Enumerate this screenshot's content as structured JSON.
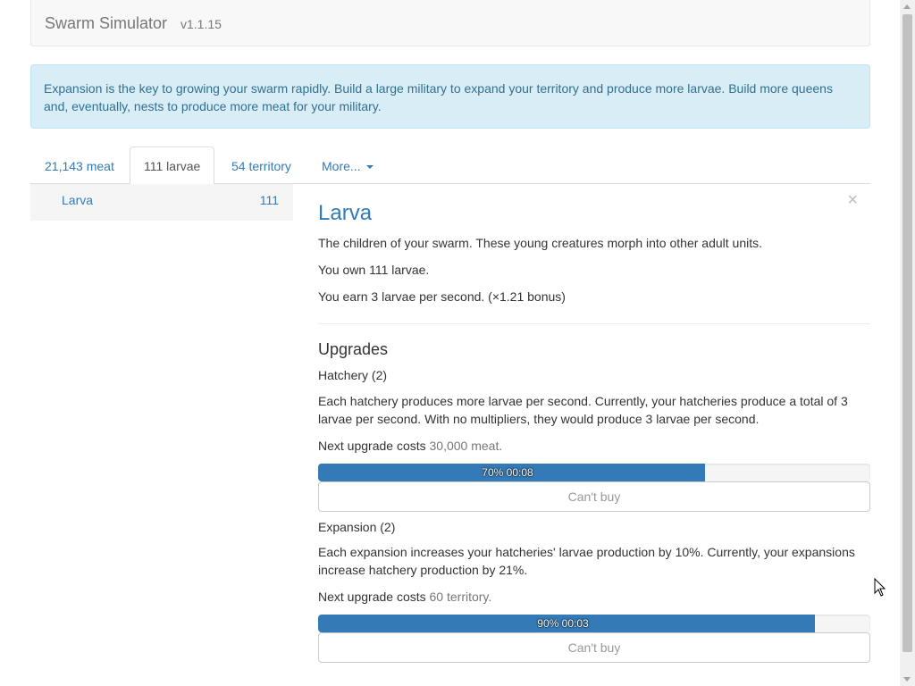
{
  "header": {
    "brand": "Swarm Simulator",
    "version": "v1.1.15"
  },
  "alert": {
    "text": "Expansion is the key to growing your swarm rapidly. Build a large military to expand your territory and produce more larvae. Build more queens and, eventually, nests to produce more meat for your military."
  },
  "tabs": [
    {
      "label": "21,143 meat",
      "active": false
    },
    {
      "label": "111 larvae",
      "active": true
    },
    {
      "label": "54 territory",
      "active": false
    },
    {
      "label": "More...",
      "active": false
    }
  ],
  "sidebar": {
    "items": [
      {
        "label": "Larva",
        "count": "111"
      }
    ]
  },
  "unit": {
    "close": "×",
    "title": "Larva",
    "description": "The children of your swarm. These young creatures morph into other adult units.",
    "owned": "You own 111 larvae.",
    "rate": "You earn 3 larvae per second. (×1.21 bonus)"
  },
  "upgrades": {
    "title": "Upgrades",
    "items": [
      {
        "name": "Hatchery (2)",
        "description": "Each hatchery produces more larvae per second. Currently, your hatcheries produce a total of 3 larvae per second. With no multipliers, they would produce 3 larvae per second.",
        "cost_prefix": "Next upgrade costs",
        "cost_value": "30,000 meat.",
        "progress": 0.7,
        "progress_label": "70% 00:08",
        "button": "Can't buy"
      },
      {
        "name": "Expansion (2)",
        "description": "Each expansion increases your hatcheries' larvae production by 10%. Currently, your expansions increase hatchery production by 21%.",
        "cost_prefix": "Next upgrade costs",
        "cost_value": "60 territory.",
        "progress": 0.9,
        "progress_label": "90% 00:03",
        "button": "Can't buy"
      }
    ]
  },
  "colors": {
    "accent": "#337ab7",
    "alert_bg": "#d9edf7",
    "alert_text": "#31708f"
  }
}
